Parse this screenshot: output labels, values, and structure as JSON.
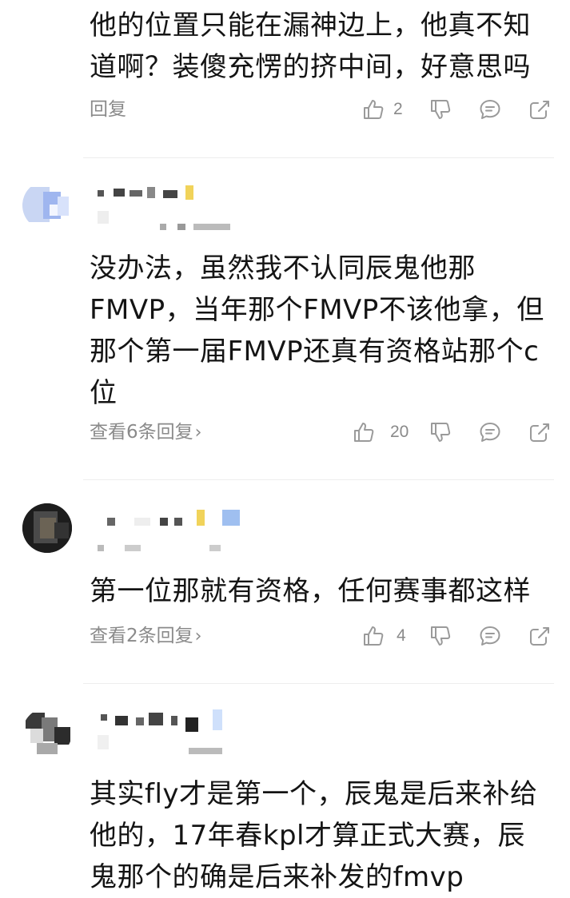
{
  "comments": [
    {
      "text": "他的位置只能在漏神边上，他真不知道啊？装傻充愣的挤中间，好意思吗",
      "reply_label": "回复",
      "likes": "2"
    },
    {
      "text": "没办法，虽然我不认同辰鬼他那FMVP，当年那个FMVP不该他拿，但那个第一届FMVP还真有资格站那个c位",
      "reply_label": "查看6条回复",
      "likes": "20"
    },
    {
      "text": "第一位那就有资格，任何赛事都这样",
      "reply_label": "查看2条回复",
      "likes": "4"
    },
    {
      "text": "其实fly才是第一个，辰鬼是后来补给他的，17年春kpl才算正式大赛，辰鬼那个的确是后来补发的fmvp"
    }
  ],
  "icons": {
    "like": "thumbs-up-icon",
    "dislike": "thumbs-down-icon",
    "comment": "comment-bubble-icon",
    "share": "share-icon",
    "chevron": "chevron-right-icon"
  },
  "colors": {
    "text": "#141414",
    "muted": "#8a8a8a",
    "icon": "#9a9a9a",
    "divider": "#ededed"
  }
}
